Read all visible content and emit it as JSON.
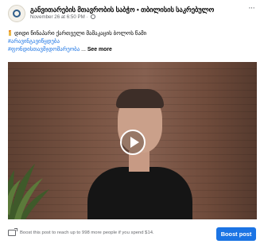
{
  "post": {
    "page_name": "განვითარების მთავრობის საბჭო • თბილისის საკრებულო",
    "timestamp": "November 26 at 6:50 PM ·",
    "audience_icon": "globe-icon",
    "caption_line1": "დიდი წინაპარი ქართველი მამაკაცის ბოლოს წამი",
    "caption_hashtag1": "#არავინგავიწყდება",
    "caption_hashtag2": "#ფონდისთავმჯდომარეობა",
    "caption_ellipsis": " ... ",
    "see_more": "See more",
    "more_options": "···"
  },
  "video": {
    "play_icon": "play-icon"
  },
  "footer": {
    "boost_text": "Boost this post to reach up to 998 more people if you spend $14.",
    "boost_button": "Boost post"
  },
  "colors": {
    "accent": "#1b74e4",
    "secondary_text": "#65676b"
  }
}
